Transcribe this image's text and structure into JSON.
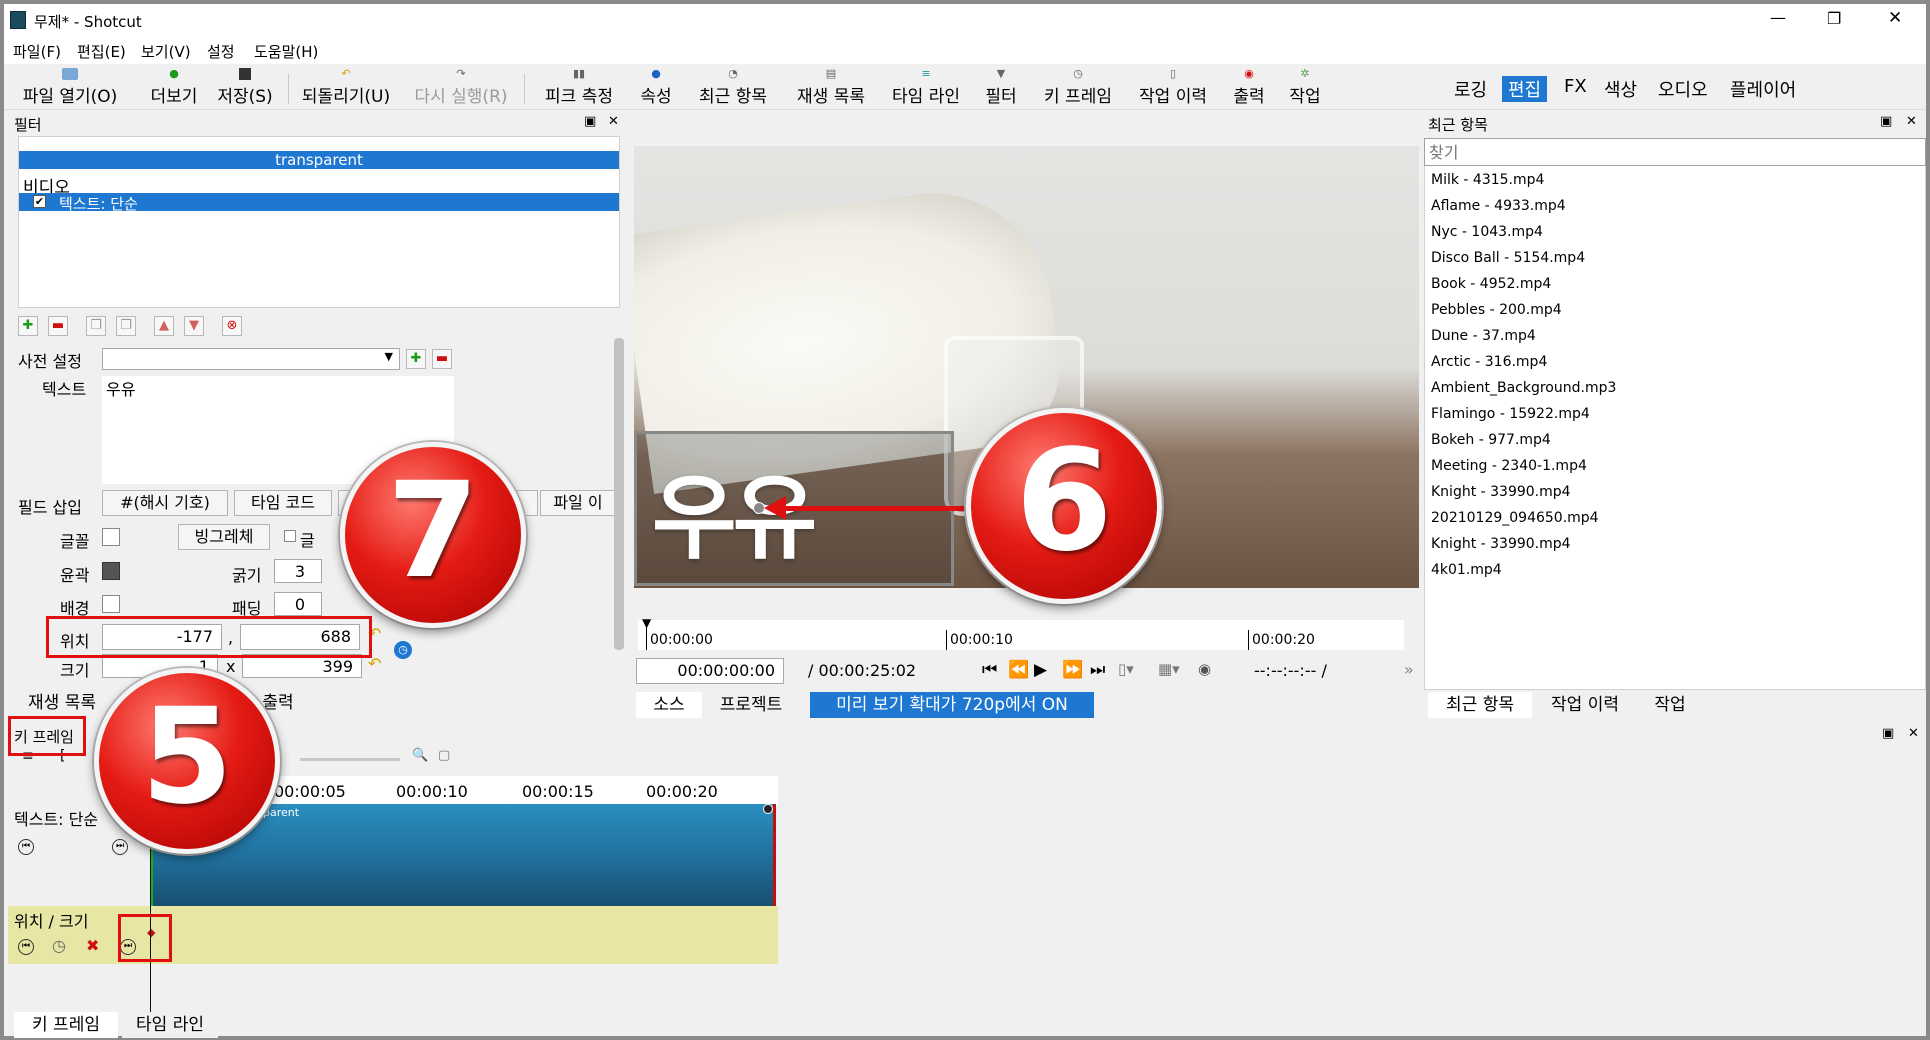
{
  "window": {
    "title": "무제* - Shotcut",
    "controls": [
      "—",
      "❐",
      "✕"
    ]
  },
  "menu": [
    "파일(F)",
    "편집(E)",
    "보기(V)",
    "설정",
    "도움말(H)"
  ],
  "toolbar": {
    "items": [
      {
        "label": "파일 열기(O)",
        "icon": "folder-open-icon"
      },
      {
        "label": "더보기",
        "icon": "add-icon"
      },
      {
        "label": "저장(S)",
        "icon": "save-icon"
      },
      {
        "label": "되돌리기(U)",
        "icon": "undo-icon"
      },
      {
        "label": "다시 실행(R)",
        "icon": "redo-icon"
      },
      {
        "label": "피크 측정",
        "icon": "peak-meter-icon"
      },
      {
        "label": "속성",
        "icon": "info-icon"
      },
      {
        "label": "최근 항목",
        "icon": "recent-icon"
      },
      {
        "label": "재생 목록",
        "icon": "playlist-icon"
      },
      {
        "label": "타임 라인",
        "icon": "timeline-icon"
      },
      {
        "label": "필터",
        "icon": "filter-icon"
      },
      {
        "label": "키 프레임",
        "icon": "keyframe-icon"
      },
      {
        "label": "작업 이력",
        "icon": "history-icon"
      },
      {
        "label": "출력",
        "icon": "export-icon"
      },
      {
        "label": "작업",
        "icon": "jobs-icon"
      }
    ],
    "workspaces": [
      "로깅",
      "편집",
      "FX",
      "색상",
      "오디오",
      "플레이어"
    ],
    "active_workspace": "편집"
  },
  "filters_panel": {
    "title": "필터",
    "clip_name": "transparent",
    "category": "비디오",
    "selected_filter": "텍스트: 단순",
    "preset_label": "사전 설정",
    "text_label": "텍스트",
    "text_value": "우유",
    "insert_field_label": "필드 삽입",
    "insert_buttons": [
      "#(해시 기호)",
      "타임 코드",
      "파일 이"
    ],
    "font_label": "글꼴",
    "font_button": "빙그레체",
    "font_check_label": "글",
    "outline_label": "윤곽",
    "thickness_label": "굵기",
    "thickness_value": "3",
    "background_label": "배경",
    "padding_label": "패딩",
    "padding_value": "0",
    "position_label": "위치",
    "position_x": "-177",
    "position_sep": ",",
    "position_y": "688",
    "size_label": "크기",
    "size_x": "x",
    "size_y": "399",
    "size_w_partial": "1",
    "bottom_tabs": [
      "재생 목록",
      "출력"
    ]
  },
  "viewer": {
    "overlay_text": "우유",
    "ruler": [
      "00:00:00",
      "00:00:10",
      "00:00:20"
    ],
    "timecode": "00:00:00:00",
    "duration": "/ 00:00:25:02",
    "inout": "--:--:--:-- /",
    "more": "»",
    "tabs": [
      "소스",
      "프로젝트"
    ],
    "zoom_notice": "미리 보기 확대가 720p에서 ON"
  },
  "recent_panel": {
    "title": "최근 항목",
    "search_placeholder": "찾기",
    "items": [
      "Milk - 4315.mp4",
      "Aflame - 4933.mp4",
      "Nyc - 1043.mp4",
      "Disco Ball - 5154.mp4",
      "Book - 4952.mp4",
      "Pebbles - 200.mp4",
      "Dune - 37.mp4",
      "Arctic - 316.mp4",
      "Ambient_Background.mp3",
      "Flamingo - 15922.mp4",
      "Bokeh - 977.mp4",
      "Meeting - 2340-1.mp4",
      "Knight - 33990.mp4",
      "20210129_094650.mp4",
      "Knight - 33990.mp4",
      "4k01.mp4"
    ],
    "tabs": [
      "최근 항목",
      "작업 이력",
      "작업"
    ]
  },
  "keyframes_panel": {
    "title": "키 프레임",
    "ruler": [
      "00:00:05",
      "00:00:10",
      "00:00:15",
      "00:00:20"
    ],
    "track_label": "텍스트: 단순",
    "clip_name": "parent",
    "param_label": "위치 / 크기",
    "bottom_tabs": [
      "키 프레임",
      "타임 라인"
    ]
  },
  "badges": [
    "7",
    "6",
    "5"
  ],
  "colors": {
    "accent": "#1e78d2",
    "callout": "#e01010",
    "keyframe_lane": "#e8e6a4",
    "clip": "#1f6e9a"
  }
}
